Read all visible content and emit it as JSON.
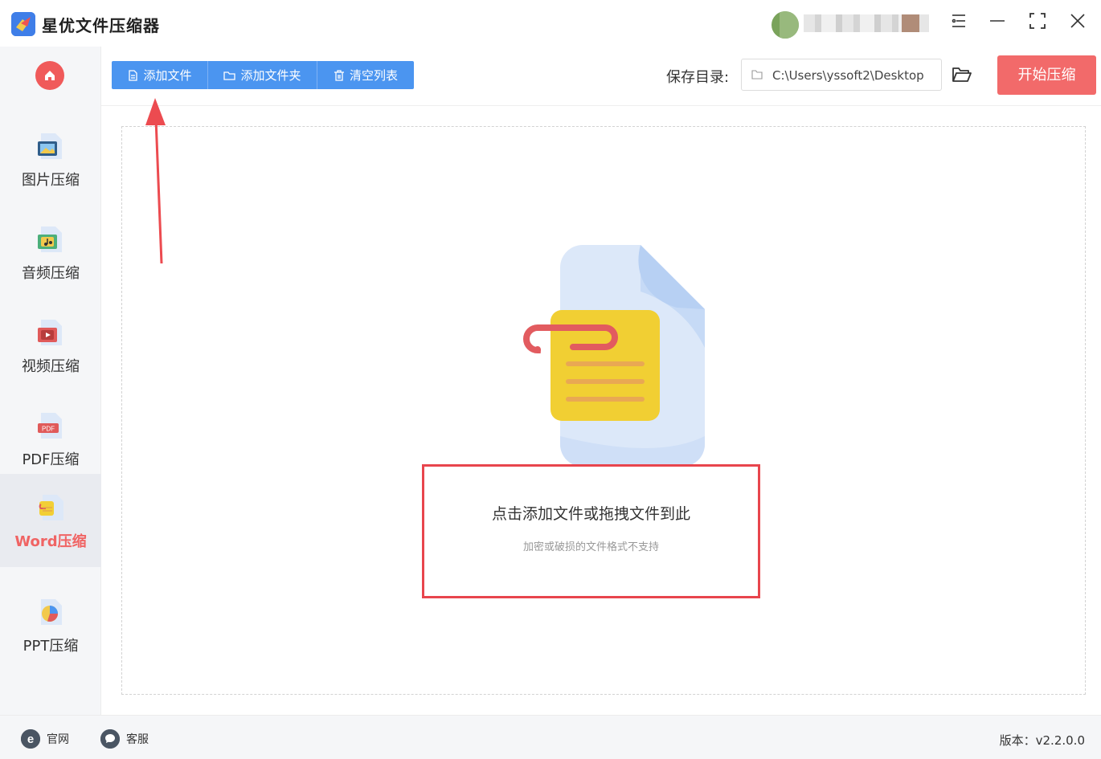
{
  "window": {
    "title": "星优文件压缩器",
    "controls": [
      "menu-icon",
      "minimize-icon",
      "maximize-icon",
      "close-icon"
    ]
  },
  "sidebar": {
    "home_icon": "home-icon",
    "items": [
      {
        "label": "图片压缩",
        "icon": "image-file-icon",
        "active": false
      },
      {
        "label": "音频压缩",
        "icon": "audio-file-icon",
        "active": false
      },
      {
        "label": "视频压缩",
        "icon": "video-file-icon",
        "active": false
      },
      {
        "label": "PDF压缩",
        "icon": "pdf-file-icon",
        "active": false
      },
      {
        "label": "Word压缩",
        "icon": "word-file-icon",
        "active": true
      },
      {
        "label": "PPT压缩",
        "icon": "ppt-file-icon",
        "active": false
      }
    ]
  },
  "toolbar": {
    "add_file": "添加文件",
    "add_folder": "添加文件夹",
    "clear_list": "清空列表",
    "save_dir_label": "保存目录:",
    "save_dir_path": "C:\\Users\\yssoft2\\Desktop",
    "start_button": "开始压缩"
  },
  "dropzone": {
    "title": "点击添加文件或拖拽文件到此",
    "subtitle": "加密或破损的文件格式不支持"
  },
  "footer": {
    "website": "官网",
    "service": "客服",
    "version": "版本：v2.2.0.0"
  },
  "colors": {
    "primary_blue": "#4b95f0",
    "accent_red": "#f26a6a",
    "active_label": "#f06464",
    "highlight_border": "#e8454d"
  }
}
